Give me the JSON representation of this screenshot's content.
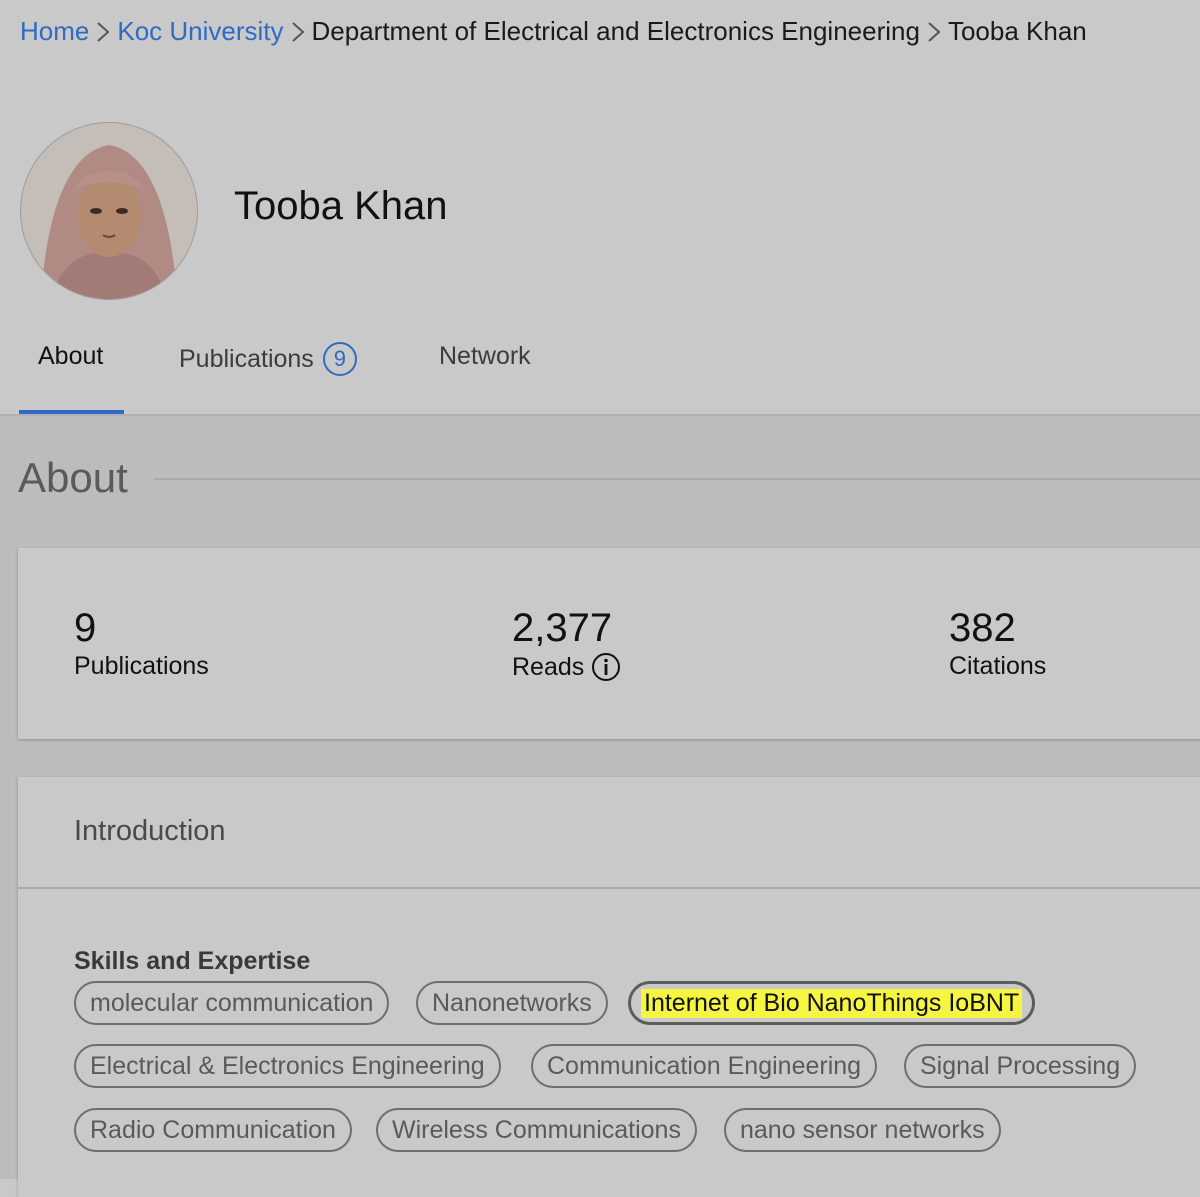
{
  "breadcrumb": {
    "home": "Home",
    "institution": "Koc University",
    "department": "Department of Electrical and Electronics Engineering",
    "person": "Tooba Khan"
  },
  "profile": {
    "name": "Tooba Khan"
  },
  "tabs": {
    "about": "About",
    "publications": "Publications",
    "publications_count": "9",
    "network": "Network"
  },
  "about": {
    "title": "About",
    "stats": {
      "publications_value": "9",
      "publications_label": "Publications",
      "reads_value": "2,377",
      "reads_label": "Reads",
      "citations_value": "382",
      "citations_label": "Citations"
    }
  },
  "introduction": {
    "title": "Introduction",
    "skills_heading": "Skills and Expertise",
    "skills": [
      "molecular communication",
      "Nanonetworks",
      "Internet of Bio NanoThings IoBNT",
      "Electrical & Electronics Engineering",
      "Communication Engineering",
      "Signal Processing",
      "Radio Communication",
      "Wireless Communications",
      "nano sensor networks"
    ]
  },
  "colors": {
    "link": "#2f6bc4",
    "page_bg": "#c9c9c9",
    "highlight": "#f5f542"
  },
  "icons": [
    "chevron-right-icon",
    "info-icon"
  ]
}
